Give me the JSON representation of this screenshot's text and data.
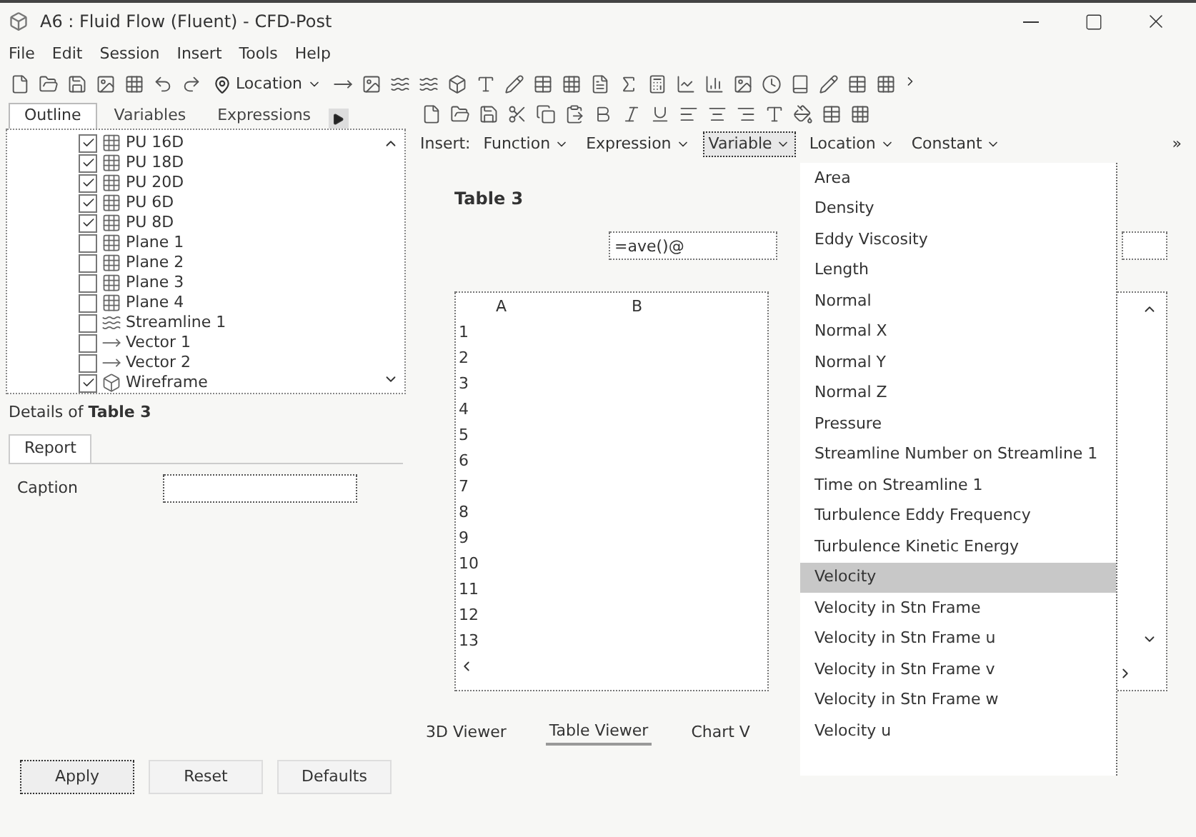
{
  "window": {
    "title": "A6 : Fluid Flow (Fluent) - CFD-Post"
  },
  "menu": [
    "File",
    "Edit",
    "Session",
    "Insert",
    "Tools",
    "Help"
  ],
  "toolbar": {
    "location_button": "Location"
  },
  "left_tabs": [
    {
      "label": "Outline",
      "selected": true
    },
    {
      "label": "Variables",
      "selected": false
    },
    {
      "label": "Expressions",
      "selected": false
    }
  ],
  "tree": [
    {
      "label": "PU 16D",
      "checked": true,
      "kind": "surface"
    },
    {
      "label": "PU 18D",
      "checked": true,
      "kind": "surface"
    },
    {
      "label": "PU 20D",
      "checked": true,
      "kind": "surface"
    },
    {
      "label": "PU 6D",
      "checked": true,
      "kind": "surface"
    },
    {
      "label": "PU 8D",
      "checked": true,
      "kind": "surface"
    },
    {
      "label": "Plane 1",
      "checked": false,
      "kind": "surface"
    },
    {
      "label": "Plane 2",
      "checked": false,
      "kind": "surface"
    },
    {
      "label": "Plane 3",
      "checked": false,
      "kind": "surface"
    },
    {
      "label": "Plane 4",
      "checked": false,
      "kind": "surface"
    },
    {
      "label": "Streamline 1",
      "checked": false,
      "kind": "streamline"
    },
    {
      "label": "Vector 1",
      "checked": false,
      "kind": "vector"
    },
    {
      "label": "Vector 2",
      "checked": false,
      "kind": "vector"
    },
    {
      "label": "Wireframe",
      "checked": true,
      "kind": "wireframe"
    }
  ],
  "details": {
    "title": "Details of **Table 3**",
    "tabs": [
      {
        "label": "Report",
        "selected": true
      }
    ],
    "caption_label": "Caption",
    "buttons": [
      "Apply",
      "Reset",
      "Defaults"
    ]
  },
  "insert_bar": {
    "label": "Insert:",
    "items": [
      {
        "label": "Function",
        "open": false
      },
      {
        "label": "Expression",
        "open": false
      },
      {
        "label": "Variable",
        "open": true
      },
      {
        "label": "Location",
        "open": false
      },
      {
        "label": "Constant",
        "open": false
      }
    ],
    "more": "»"
  },
  "table": {
    "title": "Table 3",
    "formula": "=ave()@",
    "columns": [
      "A",
      "B"
    ],
    "rows": [
      "1",
      "2",
      "3",
      "4",
      "5",
      "6",
      "7",
      "8",
      "9",
      "10",
      "11",
      "12",
      "13"
    ]
  },
  "viewer_tabs": [
    {
      "label": "3D Viewer",
      "selected": false
    },
    {
      "label": "Table Viewer",
      "selected": true
    },
    {
      "label": "Chart V",
      "selected": false
    }
  ],
  "variable_menu": [
    {
      "label": "Area",
      "selected": false
    },
    {
      "label": "Density",
      "selected": false
    },
    {
      "label": "Eddy Viscosity",
      "selected": false
    },
    {
      "label": "Length",
      "selected": false
    },
    {
      "label": "Normal",
      "selected": false
    },
    {
      "label": "Normal X",
      "selected": false
    },
    {
      "label": "Normal Y",
      "selected": false
    },
    {
      "label": "Normal Z",
      "selected": false
    },
    {
      "label": "Pressure",
      "selected": false
    },
    {
      "label": "Streamline Number on Streamline 1",
      "selected": false
    },
    {
      "label": "Time on Streamline 1",
      "selected": false
    },
    {
      "label": "Turbulence Eddy Frequency",
      "selected": false
    },
    {
      "label": "Turbulence Kinetic Energy",
      "selected": false
    },
    {
      "label": "Velocity",
      "selected": true
    },
    {
      "label": "Velocity in Stn Frame",
      "selected": false
    },
    {
      "label": "Velocity in Stn Frame u",
      "selected": false
    },
    {
      "label": "Velocity in Stn Frame v",
      "selected": false
    },
    {
      "label": "Velocity in Stn Frame w",
      "selected": false
    },
    {
      "label": "Velocity u",
      "selected": false
    }
  ]
}
